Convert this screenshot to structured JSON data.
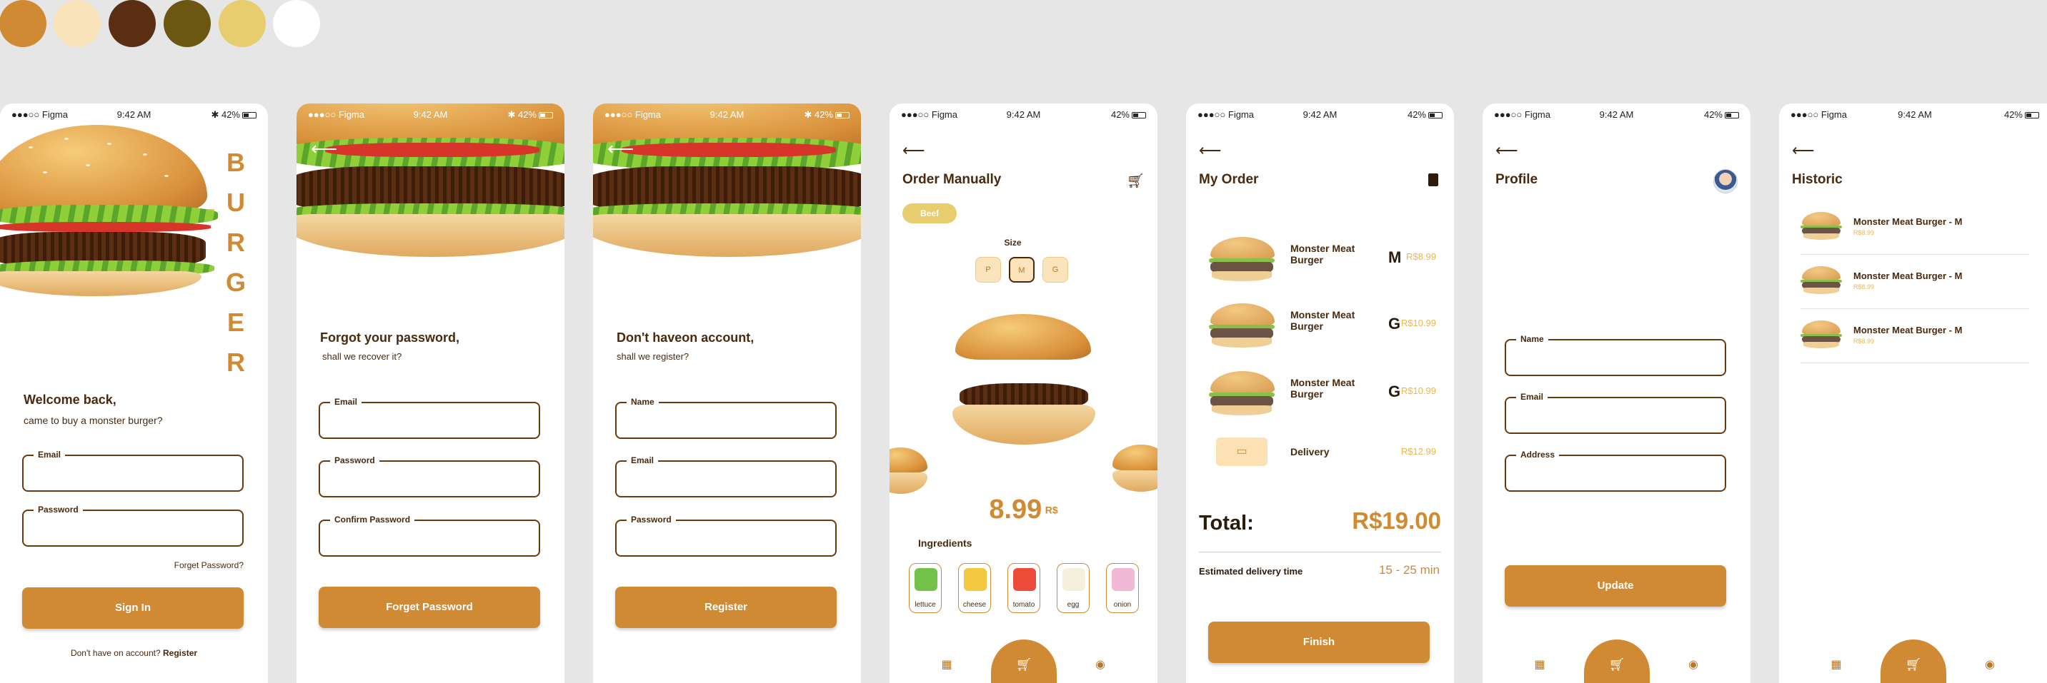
{
  "palette": [
    "#d08a34",
    "#f9e3bb",
    "#5a2e12",
    "#6b5612",
    "#e8cd6e",
    "#ffffff"
  ],
  "status": {
    "carrier": "●●●○○ Figma",
    "time": "9:42 AM",
    "battery": "42%"
  },
  "login": {
    "brand_letters": [
      "B",
      "U",
      "R",
      "G",
      "E",
      "R"
    ],
    "title": "Welcome back,",
    "subtitle": "came to buy a monster burger?",
    "email_label": "Email",
    "password_label": "Password",
    "forgot_link": "Forget Password?",
    "sign_in": "Sign In",
    "no_account": "Don't have on account?",
    "register_link": "Register"
  },
  "forgot": {
    "title": "Forgot your password,",
    "subtitle": "shall we recover it?",
    "email_label": "Email",
    "password_label": "Password",
    "confirm_label": "Confirm Password",
    "button": "Forget Password"
  },
  "register": {
    "title": "Don't haveon account,",
    "subtitle": "shall we register?",
    "name_label": "Name",
    "email_label": "Email",
    "password_label": "Password",
    "button": "Register"
  },
  "order_manually": {
    "title": "Order Manually",
    "chip": "Beef",
    "size_label": "Size",
    "sizes": [
      "P",
      "M",
      "G"
    ],
    "selected_size": "M",
    "price": "8.99",
    "currency": "R$",
    "ingredients_title": "Ingredients",
    "ingredients": [
      "lettuce",
      "cheese",
      "tomato",
      "egg",
      "onion"
    ]
  },
  "my_order": {
    "title": "My Order",
    "items": [
      {
        "name_line1": "Monster Meat",
        "name_line2": "Burger",
        "size": "M",
        "price": "R$8.99"
      },
      {
        "name_line1": "Monster Meat",
        "name_line2": "Burger",
        "size": "G",
        "price": "R$10.99"
      },
      {
        "name_line1": "Monster Meat",
        "name_line2": "Burger",
        "size": "G",
        "price": "R$10.99"
      }
    ],
    "delivery_label": "Delivery",
    "delivery_price": "R$12.99",
    "total_label": "Total:",
    "total_value": "R$19.00",
    "eta_label": "Estimated delivery time",
    "eta_value": "15 - 25 min",
    "finish": "Finish"
  },
  "profile": {
    "title": "Profile",
    "name_label": "Name",
    "email_label": "Email",
    "address_label": "Address",
    "update": "Update"
  },
  "historic": {
    "title": "Historic",
    "items": [
      {
        "name": "Monster Meat Burger - M",
        "price": "R$8.99"
      },
      {
        "name": "Monster Meat Burger - M",
        "price": "R$8.99"
      },
      {
        "name": "Monster Meat Burger - M",
        "price": "R$8.99"
      }
    ]
  }
}
